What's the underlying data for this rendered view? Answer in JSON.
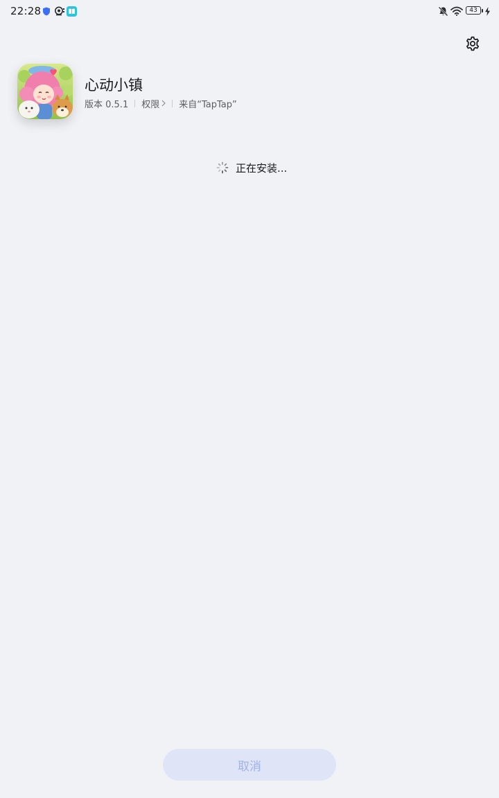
{
  "status_bar": {
    "time": "22:28",
    "battery_level": "43",
    "left_icons": [
      "shield-icon",
      "camera-icon",
      "book-app-icon"
    ],
    "right_icons": [
      "bell-off-icon",
      "wifi-icon",
      "battery-icon",
      "charging-bolt-icon"
    ]
  },
  "header": {
    "settings_icon": "gear-icon"
  },
  "app": {
    "name": "心动小镇",
    "version": "版本 0.5.1",
    "permissions_label": "权限",
    "source": "来自“TapTap”",
    "icon": "app-icon-cartoon-girl-with-dog"
  },
  "install": {
    "status_text": "正在安装...",
    "spinner_icon": "loading-spinner-icon"
  },
  "footer": {
    "cancel_label": "取消"
  },
  "colors": {
    "background": "#f1f2f6",
    "button_bg": "#dfe5f6",
    "button_text": "#9eb3ea",
    "shield_blue": "#3b6ff5",
    "book_teal": "#2ec3d8"
  }
}
